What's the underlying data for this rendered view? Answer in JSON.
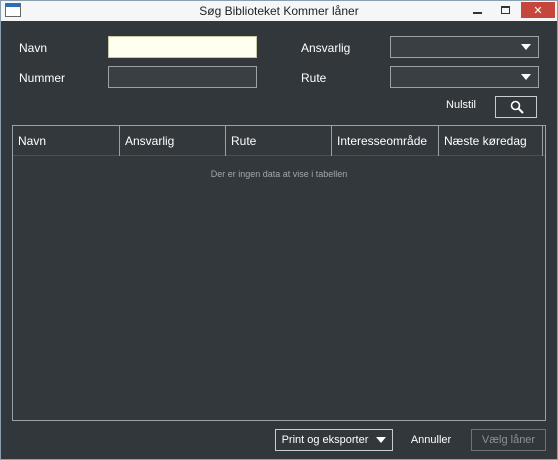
{
  "window": {
    "title": "Søg Biblioteket Kommer låner",
    "close_glyph": "✕"
  },
  "form": {
    "navn_label": "Navn",
    "navn_value": "",
    "nummer_label": "Nummer",
    "nummer_value": "",
    "ansvarlig_label": "Ansvarlig",
    "ansvarlig_value": "",
    "rute_label": "Rute",
    "rute_value": "",
    "reset_label": "Nulstil",
    "search_icon": "search-icon"
  },
  "table": {
    "columns": [
      "Navn",
      "Ansvarlig",
      "Rute",
      "Interesseområde",
      "Næste køredag"
    ],
    "rows": [],
    "empty_message": "Der er ingen data at vise i tabellen"
  },
  "footer": {
    "print_label": "Print og eksporter",
    "cancel_label": "Annuller",
    "choose_label": "Vælg låner"
  },
  "colors": {
    "background": "#32373b",
    "active_input": "#fffff0",
    "close_button": "#c7463c"
  }
}
